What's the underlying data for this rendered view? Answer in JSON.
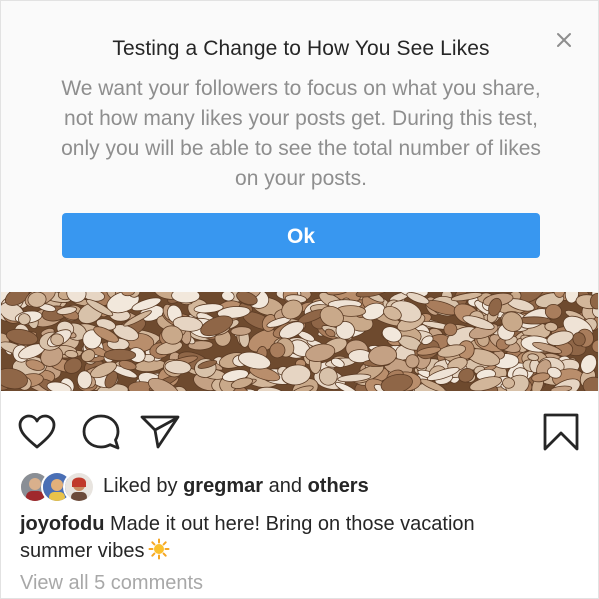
{
  "notice": {
    "title": "Testing a Change to How You See Likes",
    "body": "We want your followers to focus on what you share, not how many likes your posts get. During this test, only you will be able to see the total number of likes on your posts.",
    "ok_label": "Ok",
    "close_icon": "close-icon"
  },
  "post": {
    "photo": "stone-beach-photo",
    "actions": {
      "like_icon": "heart-icon",
      "comment_icon": "comment-icon",
      "share_icon": "send-icon",
      "save_icon": "bookmark-icon"
    },
    "likes": {
      "prefix": "Liked by",
      "user": "gregmar",
      "conjunction": "and",
      "others": "others"
    },
    "caption": {
      "username": "joyofodu",
      "text": "Made it out here! Bring on those vacation summer vibes",
      "emoji_icon": "sun-emoji-icon"
    },
    "view_comments": "View all 5 comments"
  },
  "colors": {
    "accent": "#3897f0",
    "text_primary": "#262626",
    "text_secondary": "#8e8e8e",
    "banner_bg": "#fafafa"
  }
}
